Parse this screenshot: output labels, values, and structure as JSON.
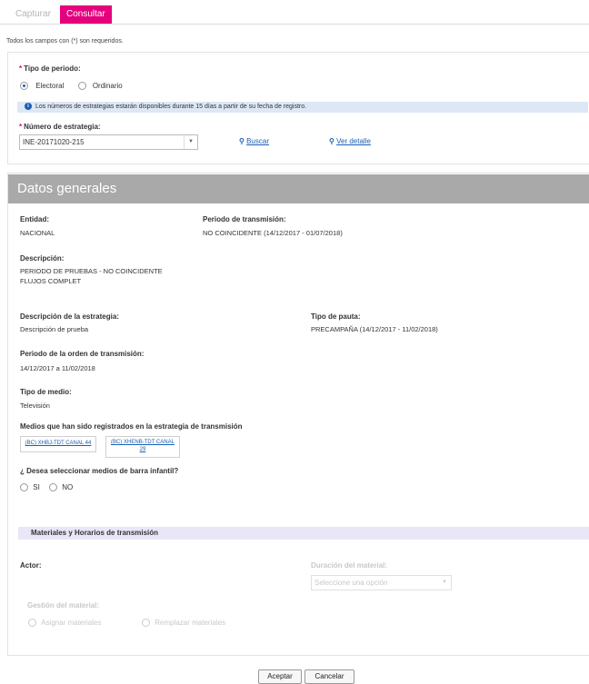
{
  "tabs": {
    "capturar": "Capturar",
    "consultar": "Consultar"
  },
  "note": "Todos los campos con (*) son requeridos.",
  "periodo": {
    "label": "Tipo de periodo:",
    "options": [
      "Electoral",
      "Ordinario"
    ],
    "selected": "Electoral"
  },
  "info_text": "Los números de estrategias estarán disponibles durante 15 días a partir de su fecha de registro.",
  "estrategia": {
    "label": "Número de estrategia:",
    "value": "INE-20171020-215",
    "buscar": "Buscar",
    "ver_detalle": "Ver detalle"
  },
  "datos": {
    "title": "Datos generales",
    "entidad_label": "Entidad:",
    "entidad": "NACIONAL",
    "periodo_trans_label": "Periodo de transmisión:",
    "periodo_trans": "NO COINCIDENTE (14/12/2017 - 01/07/2018)",
    "descripcion_label": "Descripción:",
    "descripcion_1": "PERIODO DE PRUEBAS - NO COINCIDENTE",
    "descripcion_2": "FLUJOS COMPLET",
    "desc_estrategia_label": "Descripción de la estrategia:",
    "desc_estrategia": "Descripción de prueba",
    "tipo_pauta_label": "Tipo de pauta:",
    "tipo_pauta": "PRECAMPAÑA (14/12/2017 - 11/02/2018)",
    "periodo_orden_label": "Periodo de la orden de transmisión:",
    "periodo_orden": "14/12/2017 a 11/02/2018",
    "tipo_medio_label": "Tipo de medio:",
    "tipo_medio": "Televisión",
    "medios_label": "Medios que han sido registrados en la estrategia de transmisión",
    "medio_1": "(BC) XHBJ-TDT CANAL 44",
    "medio_2a": "(BC) XHENB-TDT CANAL",
    "medio_2b": "29",
    "barra_label": "¿ Desea seleccionar medios de barra infantil?",
    "barra_si": "SI",
    "barra_no": "NO"
  },
  "materiales": {
    "title": "Materiales y Horarios de transmisión",
    "actor_label": "Actor:",
    "duracion_label": "Duración del material:",
    "duracion_placeholder": "Seleccione una opción",
    "gestion_label": "Gestión del material:",
    "asignar": "Asignar materiales",
    "remplazar": "Remplazar materiales"
  },
  "buttons": {
    "aceptar": "Aceptar",
    "cancelar": "Cancelar"
  },
  "colors": {
    "accent": "#e5007e",
    "link": "#1a5fb4",
    "header": "#a9a9a9",
    "info": "#dde7f5",
    "purple": "#e9e6f8"
  }
}
